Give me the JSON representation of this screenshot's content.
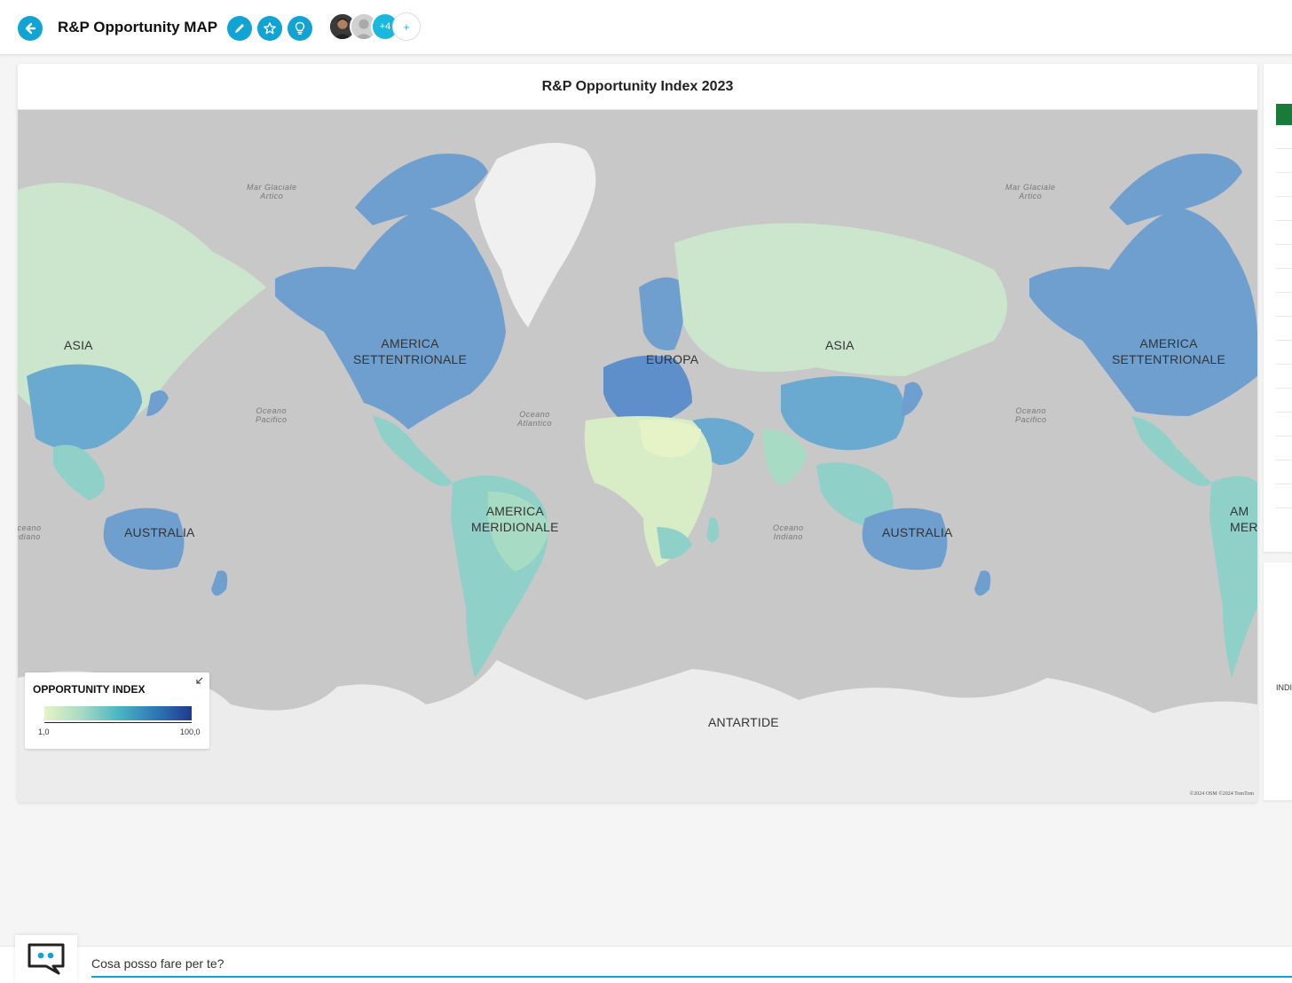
{
  "header": {
    "title": "R&P Opportunity MAP",
    "extra_collaborators": "+4",
    "add_collaborator": "+"
  },
  "map_card": {
    "title": "R&P Opportunity Index 2023",
    "continents": {
      "asia_left": "ASIA",
      "north_america": "AMERICA\nSETTENTRIONALE",
      "europe": "EUROPA",
      "asia": "ASIA",
      "north_america_right": "AMERICA\nSETTENTRIONALE",
      "south_america": "AMERICA\nMERIDIONALE",
      "australia_left": "AUSTRALIA",
      "australia_right": "AUSTRALIA",
      "antarctica": "ANTARTIDE",
      "south_america_right_partial": "AM\nMER"
    },
    "oceans": {
      "arctic_left": "Mar Glaciale\nArtico",
      "arctic_right": "Mar Glaciale\nArtico",
      "pacific_left": "Oceano\nPacifico",
      "pacific_right": "Oceano\nPacifico",
      "atlantic": "Oceano\nAtlantico",
      "indian": "Oceano\nIndiano",
      "indian_left_partial": "Oceano\nIndiano"
    },
    "copyright": "©2024 OSM ©2024 TomTom",
    "legend": {
      "title": "OPPORTUNITY INDEX",
      "min": "1,0",
      "max": "100,0",
      "collapse_icon": "collapse-arrow-icon"
    },
    "colors": {
      "low": "#e6f3c7",
      "mid_low": "#c9e6cc",
      "mid": "#8fd0c9",
      "mid_high": "#4cb6c2",
      "high": "#6f9fcf",
      "very_high": "#1f3a8f",
      "sea": "#c8c8c8",
      "ice": "#eeeeee"
    }
  },
  "right_panel": {
    "truncated_label": "INDI"
  },
  "chat": {
    "placeholder": "Cosa posso fare per te?"
  },
  "accent": "#11a3d4"
}
